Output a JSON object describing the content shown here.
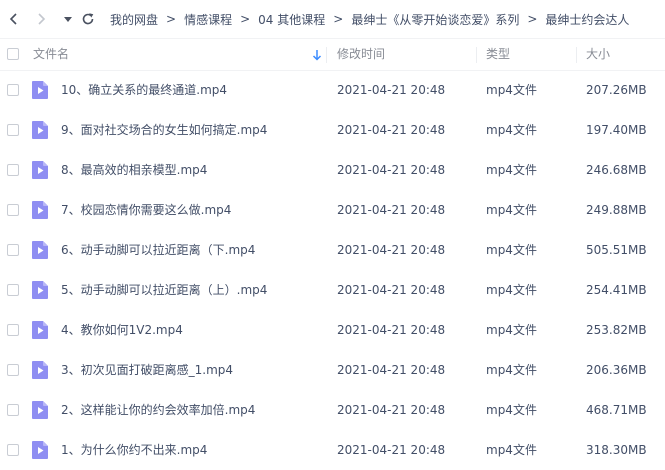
{
  "breadcrumb": {
    "items": [
      "我的网盘",
      "情感课程",
      "04 其他课程",
      "最绅士《从零开始谈恋爱》系列",
      "最绅士约会达人"
    ]
  },
  "columns": {
    "name": "文件名",
    "modified": "修改时间",
    "type": "类型",
    "size": "大小"
  },
  "files": [
    {
      "name": "10、确立关系的最终通道.mp4",
      "modified": "2021-04-21 20:48",
      "type": "mp4文件",
      "size": "207.26MB"
    },
    {
      "name": "9、面对社交场合的女生如何搞定.mp4",
      "modified": "2021-04-21 20:48",
      "type": "mp4文件",
      "size": "197.40MB"
    },
    {
      "name": "8、最高效的相亲模型.mp4",
      "modified": "2021-04-21 20:48",
      "type": "mp4文件",
      "size": "246.68MB"
    },
    {
      "name": "7、校园恋情你需要这么做.mp4",
      "modified": "2021-04-21 20:48",
      "type": "mp4文件",
      "size": "249.88MB"
    },
    {
      "name": "6、动手动脚可以拉近距离（下.mp4",
      "modified": "2021-04-21 20:48",
      "type": "mp4文件",
      "size": "505.51MB"
    },
    {
      "name": "5、动手动脚可以拉近距离（上）.mp4",
      "modified": "2021-04-21 20:48",
      "type": "mp4文件",
      "size": "254.41MB"
    },
    {
      "name": "4、教你如何1V2.mp4",
      "modified": "2021-04-21 20:48",
      "type": "mp4文件",
      "size": "253.82MB"
    },
    {
      "name": "3、初次见面打破距离感_1.mp4",
      "modified": "2021-04-21 20:48",
      "type": "mp4文件",
      "size": "206.36MB"
    },
    {
      "name": "2、这样能让你的约会效率加倍.mp4",
      "modified": "2021-04-21 20:48",
      "type": "mp4文件",
      "size": "468.71MB"
    },
    {
      "name": "1、为什么你约不出来.mp4",
      "modified": "2021-04-21 20:48",
      "type": "mp4文件",
      "size": "318.30MB"
    }
  ],
  "colors": {
    "video_icon": "#8f8ef2",
    "sort_arrow": "#3b8cff"
  },
  "icons": {
    "back": "chevron-left-icon",
    "forward": "chevron-right-icon",
    "history": "caret-down-icon",
    "refresh": "refresh-icon",
    "sort": "sort-down-arrow-icon",
    "file": "video-file-icon"
  }
}
